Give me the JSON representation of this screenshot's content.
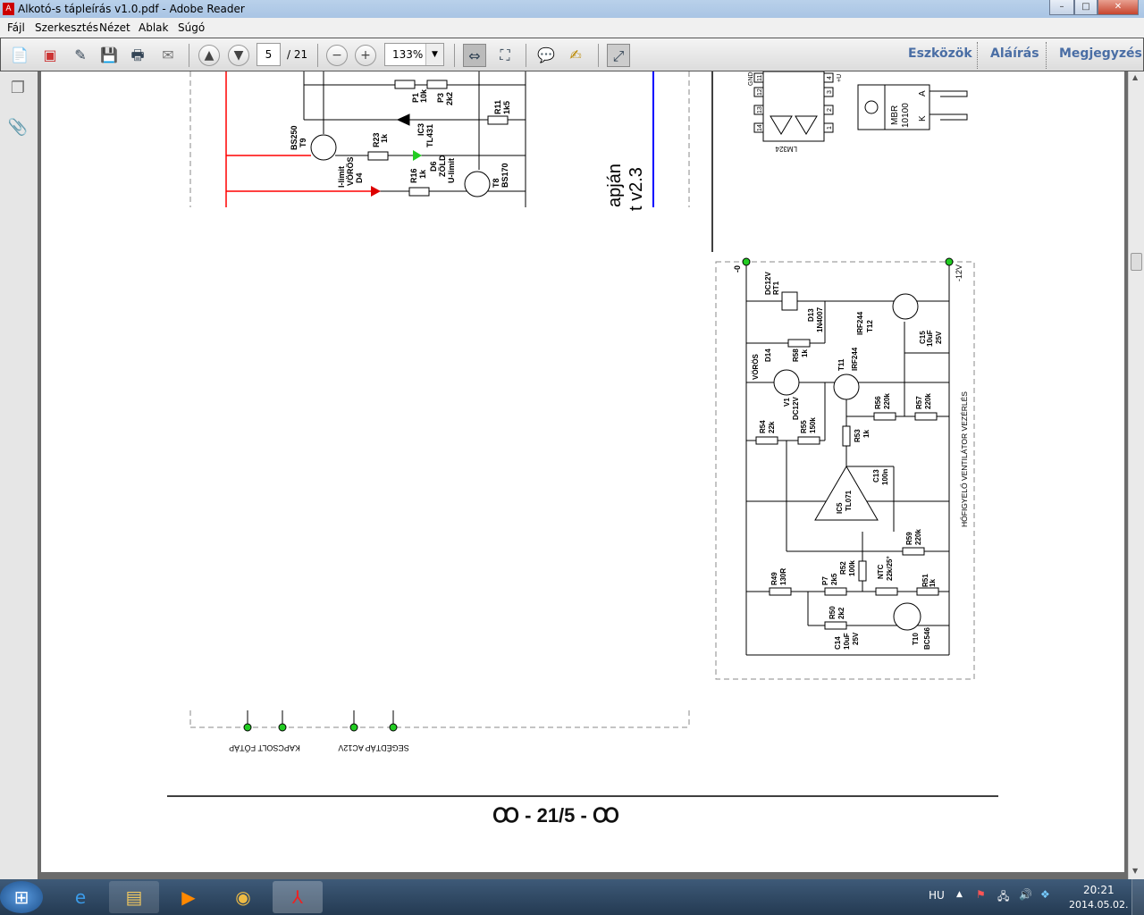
{
  "window": {
    "title": "Alkotó-s tápleírás v1.0.pdf - Adobe Reader",
    "controls": {
      "minimize": "–",
      "maximize": "□",
      "close": "✕"
    }
  },
  "menu": [
    "Fájl",
    "Szerkesztés",
    "Nézet",
    "Ablak",
    "Súgó"
  ],
  "toolbar": {
    "page_current": "5",
    "page_total": "/ 21",
    "zoom": "133%",
    "right_links": [
      "Eszközök",
      "Aláírás",
      "Megjegyzés"
    ]
  },
  "document": {
    "footer_page": "- 21/5 -",
    "footer_ornament": "Ꝏ",
    "left_schematic_labels": [
      "P1",
      "10k",
      "P3",
      "2k2",
      "R11",
      "1k5",
      "IC3",
      "TL431",
      "BS250",
      "T9",
      "R23",
      "1k",
      "D6",
      "ZÖLD",
      "U-limit",
      "I-limit",
      "VÖRÖS",
      "D4",
      "R16",
      "1k",
      "T8",
      "BS170",
      "apján",
      "t v2.3"
    ],
    "chip_labels": {
      "lm324": "LM324",
      "pins": [
        "11",
        "12",
        "13",
        "14",
        "4",
        "3",
        "2",
        "1"
      ],
      "gnd": "GND",
      "vplus": "+U",
      "mbr": "MBR",
      "mbr_num": "10100",
      "anode": "A",
      "cathode": "K"
    },
    "fan_schematic_labels": {
      "rail_left": "-0",
      "rail_right": "-12V",
      "title": "HŐFIGYELŐ VENTILÁTOR VEZÉRLÉS",
      "parts": [
        "DC12V",
        "RT1",
        "D13",
        "1N4007",
        "VÖRÖS",
        "D14",
        "R58",
        "1k",
        "IRF244",
        "T12",
        "C15",
        "10uF",
        "25V",
        "V1",
        "DC12V",
        "T11",
        "IRF244",
        "R56",
        "220k",
        "R57",
        "220k",
        "R54",
        "22k",
        "R55",
        "150k",
        "R53",
        "1k",
        "C13",
        "100n",
        "IC5",
        "TL071",
        "R59",
        "220k",
        "R52",
        "100k",
        "NTC",
        "22k/25°",
        "R49",
        "130R",
        "P7",
        "2k5",
        "R51",
        "1k",
        "R50",
        "2k2",
        "C14",
        "10uF",
        "25V",
        "T10",
        "BC546"
      ]
    },
    "connector_labels": {
      "main": "KAPCSOLT FŐTÁP",
      "aux": "SEGÉDTÁP AC12V"
    }
  },
  "taskbar": {
    "lang": "HU",
    "time": "20:21",
    "date": "2014.05.02."
  },
  "colors": {
    "wire": "#000000",
    "red_wire": "#ff0000",
    "blue_line": "#0000ff",
    "terminal": "#22cc22",
    "link": "#4a6ea5"
  }
}
